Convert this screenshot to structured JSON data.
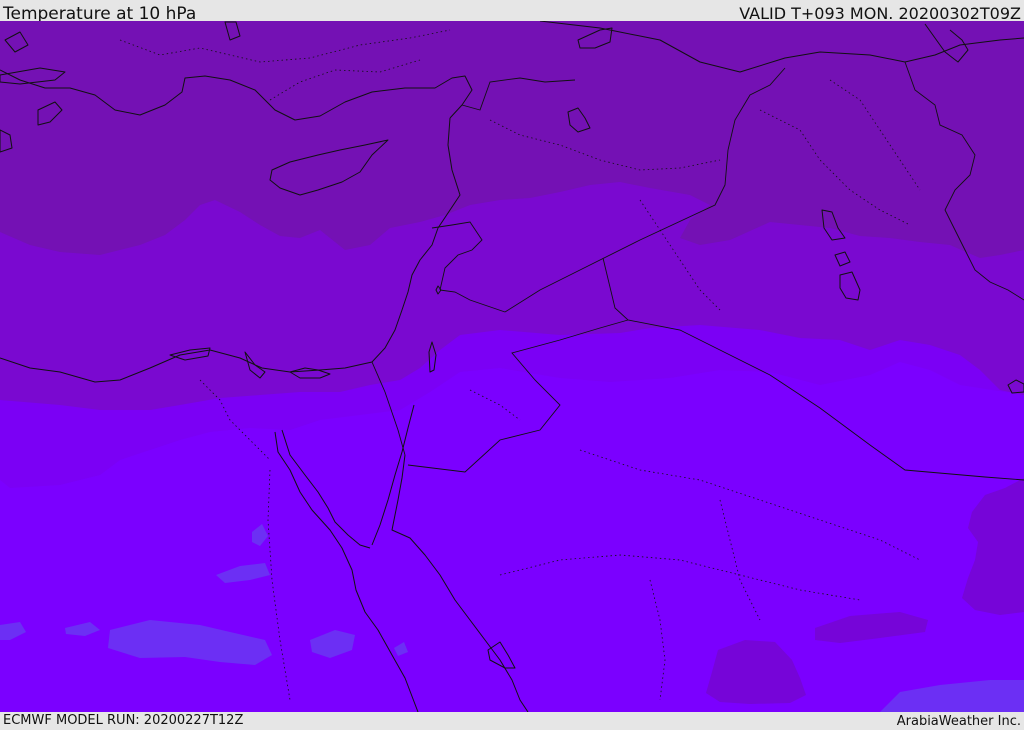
{
  "header": {
    "title": "Temperature at 10 hPa",
    "valid": "VALID T+093 MON. 20200302T09Z"
  },
  "footer": {
    "model_run": "ECMWF MODEL RUN: 20200227T12Z",
    "credit": "ArabiaWeather Inc."
  },
  "map": {
    "region": "Eastern Mediterranean and Middle East",
    "colors": {
      "coldest": "#7411b4",
      "cold": "#7a09d0",
      "medium": "#7b00f5",
      "warm": "#7b00ff",
      "warmest": "#6c2ff4",
      "dark_blob": "#7605d8",
      "coast": "#111111"
    },
    "features": [
      "temperature-bands",
      "coastlines",
      "country-borders",
      "internal-borders"
    ]
  }
}
